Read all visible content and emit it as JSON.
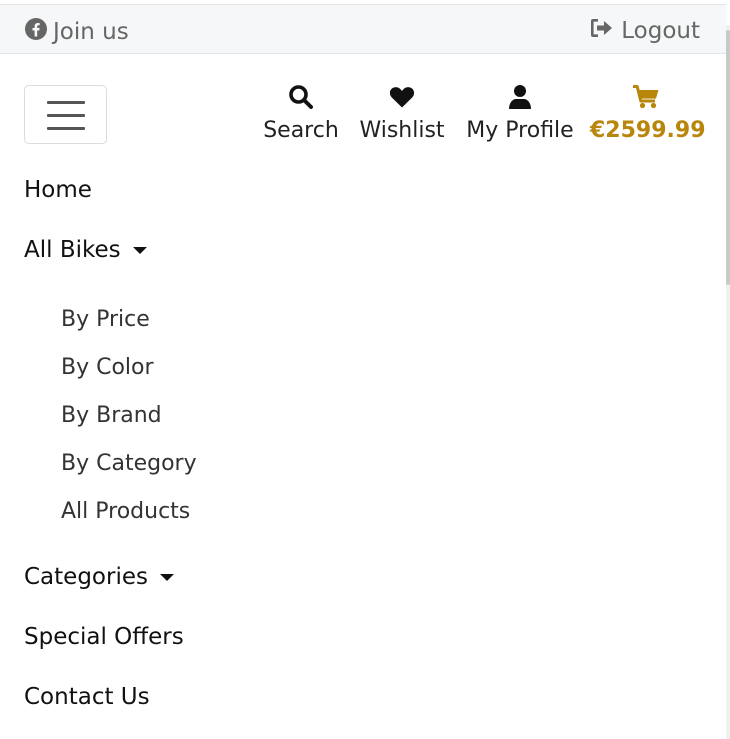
{
  "topbar": {
    "join_label": "Join us",
    "logout_label": "Logout"
  },
  "icons": {
    "join": "facebook-icon",
    "logout": "sign-out-icon",
    "search": "search-icon",
    "wishlist": "heart-icon",
    "profile": "user-icon",
    "cart": "shopping-cart-icon"
  },
  "nav": {
    "search_label": "Search",
    "wishlist_label": "Wishlist",
    "profile_label": "My Profile",
    "cart_total": "€2599.99"
  },
  "menu": {
    "home": "Home",
    "all_bikes": "All Bikes",
    "all_bikes_items": [
      "By Price",
      "By Color",
      "By Brand",
      "By Category",
      "All Products"
    ],
    "categories": "Categories",
    "special_offers": "Special Offers",
    "contact_us": "Contact Us"
  },
  "colors": {
    "accent_gold": "#b8860b",
    "topbar_bg": "#f6f7f8",
    "muted_text": "#666666"
  }
}
